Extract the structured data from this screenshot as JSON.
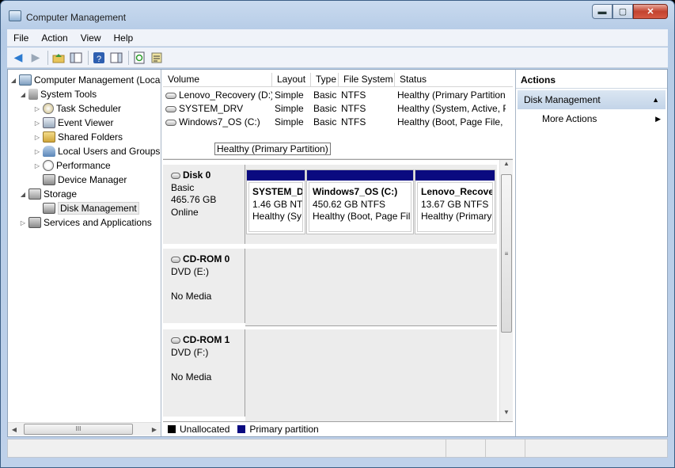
{
  "window": {
    "title": "Computer Management",
    "min": "▬",
    "max": "▢",
    "close": "✕"
  },
  "menu": [
    "File",
    "Action",
    "View",
    "Help"
  ],
  "tree": {
    "root": "Computer Management (Local",
    "system_tools": "System Tools",
    "task_scheduler": "Task Scheduler",
    "event_viewer": "Event Viewer",
    "shared_folders": "Shared Folders",
    "local_users": "Local Users and Groups",
    "performance": "Performance",
    "device_manager": "Device Manager",
    "storage": "Storage",
    "disk_management": "Disk Management",
    "services": "Services and Applications"
  },
  "volumes": {
    "columns": [
      "Volume",
      "Layout",
      "Type",
      "File System",
      "Status"
    ],
    "rows": [
      {
        "volume": "Lenovo_Recovery (D:)",
        "layout": "Simple",
        "type": "Basic",
        "fs": "NTFS",
        "status": "Healthy (Primary Partition"
      },
      {
        "volume": "SYSTEM_DRV",
        "layout": "Simple",
        "type": "Basic",
        "fs": "NTFS",
        "status": "Healthy (System, Active, P"
      },
      {
        "volume": "Windows7_OS (C:)",
        "layout": "Simple",
        "type": "Basic",
        "fs": "NTFS",
        "status": "Healthy (Boot, Page File, C"
      }
    ],
    "tooltip": "Healthy (Primary Partition)"
  },
  "disks": {
    "disk0": {
      "name": "Disk 0",
      "type": "Basic",
      "size": "465.76 GB",
      "state": "Online"
    },
    "partitions": [
      {
        "name": "SYSTEM_DI",
        "size": "1.46 GB NTF",
        "status": "Healthy (Sy"
      },
      {
        "name": "Windows7_OS  (C:)",
        "size": "450.62 GB NTFS",
        "status": "Healthy (Boot, Page Fil"
      },
      {
        "name": "Lenovo_Recove",
        "size": "13.67 GB NTFS",
        "status": "Healthy (Primary"
      }
    ],
    "cdrom0": {
      "name": "CD-ROM 0",
      "drive": "DVD (E:)",
      "media": "No Media"
    },
    "cdrom1": {
      "name": "CD-ROM 1",
      "drive": "DVD (F:)",
      "media": "No Media"
    }
  },
  "legend": {
    "unallocated": "Unallocated",
    "primary": "Primary partition",
    "unallocated_color": "#000000",
    "primary_color": "#0a0a80"
  },
  "actions": {
    "header": "Actions",
    "section": "Disk Management",
    "more": "More Actions"
  },
  "scroll": {
    "grip": "III",
    "vgrip": "≡"
  }
}
